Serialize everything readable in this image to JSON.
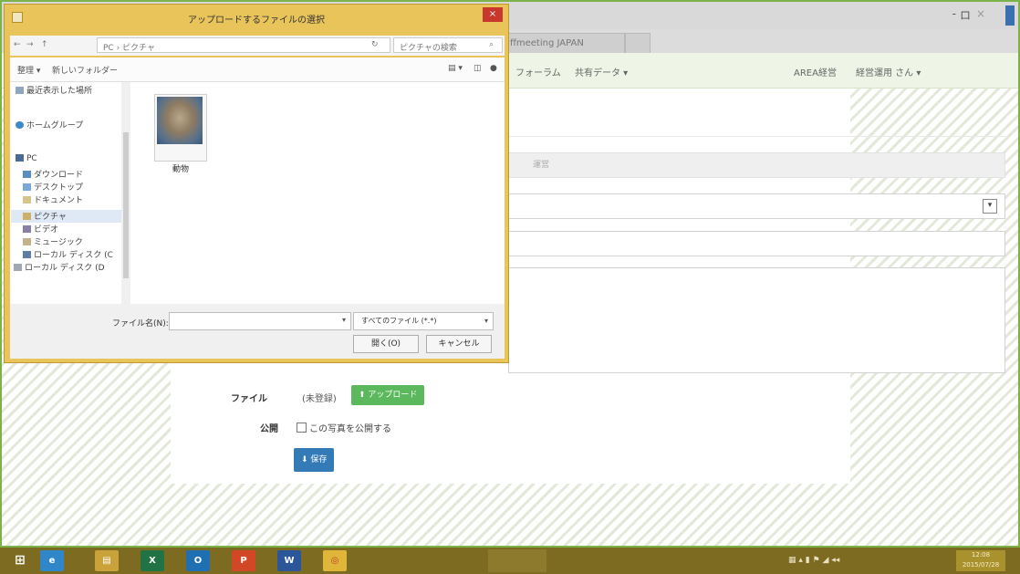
{
  "browser": {
    "tab_title": "ffmeeting JAPAN",
    "controls": [
      "-",
      "ロ",
      "×"
    ],
    "nav": [
      "フォーラム",
      "共有データ ▾"
    ],
    "user_org": "AREA経営",
    "user_menu": "経営運用 さん ▾"
  },
  "form": {
    "section_label": "運営",
    "file_label": "ファイル",
    "file_status": "(未登録)",
    "upload_label": "アップロード",
    "publish_label": "公開",
    "publish_checkbox_label": "この写真を公開する",
    "save_label": "保存"
  },
  "dialog": {
    "title": "アップロードするファイルの選択",
    "close_label": "×",
    "back_label": "←",
    "forward_label": "→",
    "up_label": "↑",
    "path": "PC › ピクチャ",
    "refresh_label": "↻",
    "search_placeholder": "ピクチャの検索",
    "organize_label": "整理 ▾",
    "new_folder_label": "新しいフォルダー",
    "nav_items": [
      "最近表示した場所",
      "ホームグループ",
      "PC",
      "ダウンロード",
      "デスクトップ",
      "ドキュメント",
      "ピクチャ",
      "ビデオ",
      "ミュージック",
      "ローカル ディスク (C",
      "ローカル ディスク (D"
    ],
    "file_name": "動物",
    "filename_label": "ファイル名(N):",
    "filetype_value": "すべてのファイル (*.*)",
    "open_label": "開く(O)",
    "cancel_label": "キャンセル"
  },
  "taskbar": {
    "apps": [
      "⊞",
      "e",
      "▤",
      "X",
      "O",
      "P",
      "W",
      "◎"
    ],
    "time": "12:08",
    "date": "2015/07/28"
  }
}
